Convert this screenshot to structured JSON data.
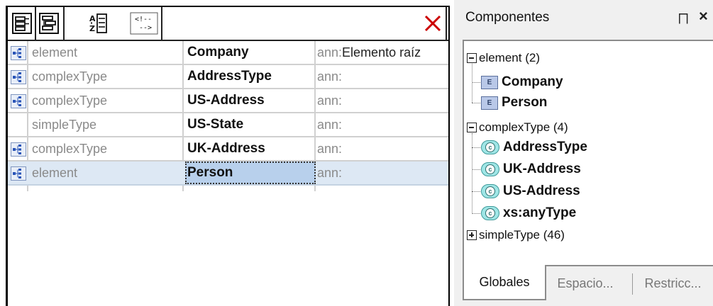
{
  "toolbar": {
    "buttons": [
      {
        "name": "display-all-globals-icon"
      },
      {
        "name": "display-diagram-icon"
      },
      {
        "name": "sort-components-icon"
      },
      {
        "name": "insert-comment-icon",
        "glyph_top": "<!--",
        "glyph_bottom": "-->"
      },
      {
        "name": "delete-component-icon"
      }
    ]
  },
  "schema_rows": [
    {
      "kind": "element",
      "name": "Company",
      "ann_prefix": "ann:",
      "ann_text": "Elemento raíz",
      "has_icon": true,
      "selected": false
    },
    {
      "kind": "complexType",
      "name": "AddressType",
      "ann_prefix": "ann:",
      "ann_text": "",
      "has_icon": true,
      "selected": false
    },
    {
      "kind": "complexType",
      "name": "US-Address",
      "ann_prefix": "ann:",
      "ann_text": "",
      "has_icon": true,
      "selected": false
    },
    {
      "kind": "simpleType",
      "name": "US-State",
      "ann_prefix": "ann:",
      "ann_text": "",
      "has_icon": false,
      "selected": false
    },
    {
      "kind": "complexType",
      "name": "UK-Address",
      "ann_prefix": "ann:",
      "ann_text": "",
      "has_icon": true,
      "selected": false
    },
    {
      "kind": "element",
      "name": "Person",
      "ann_prefix": "ann:",
      "ann_text": "",
      "has_icon": true,
      "selected": true
    }
  ],
  "components": {
    "title": "Componentes",
    "pin_glyph": "⨅",
    "close_glyph": "×",
    "tree": {
      "element_group": {
        "label": "element (2)",
        "expanded": true,
        "items": [
          {
            "badge": "E",
            "label": "Company"
          },
          {
            "badge": "E",
            "label": "Person"
          }
        ]
      },
      "complex_group": {
        "label": "complexType (4)",
        "expanded": true,
        "items": [
          {
            "badge": "c",
            "label": "AddressType"
          },
          {
            "badge": "c",
            "label": "UK-Address"
          },
          {
            "badge": "c",
            "label": "US-Address"
          },
          {
            "badge": "c",
            "label": "xs:anyType"
          }
        ]
      },
      "simple_group": {
        "label": "simpleType (46)",
        "expanded": false
      }
    },
    "tabs": [
      {
        "label": "Globales",
        "active": true
      },
      {
        "label": "Espacio...",
        "active": false
      },
      {
        "label": "Restricc...",
        "active": false
      }
    ]
  },
  "colors": {
    "selection": "#dde8f4",
    "element_badge": "#b9c8e8",
    "complex_badge": "#9fe6e6",
    "delete_red": "#cc0000"
  }
}
